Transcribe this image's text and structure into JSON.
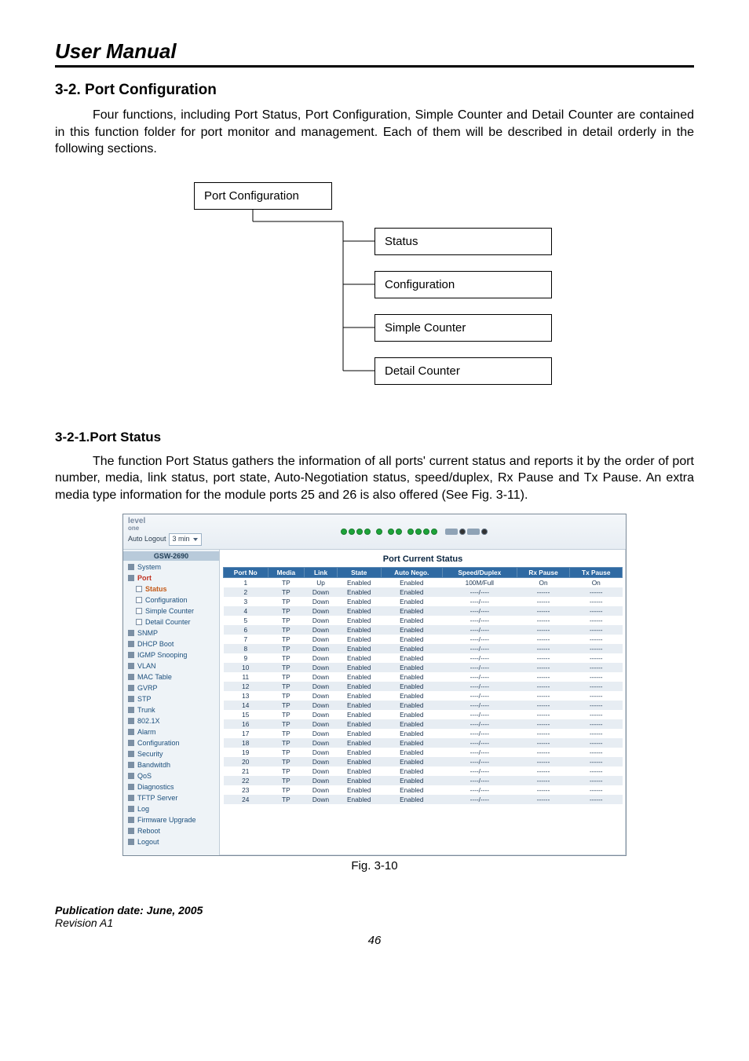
{
  "header": {
    "title": "User Manual"
  },
  "section": {
    "heading": "3-2. Port Configuration",
    "para": "Four functions, including Port Status, Port Configuration, Simple Counter and Detail Counter are contained in this function folder for port monitor and management. Each of them will be described in detail orderly in the following sections."
  },
  "tree": {
    "root": "Port Configuration",
    "children": [
      "Status",
      "Configuration",
      "Simple Counter",
      "Detail Counter"
    ]
  },
  "subsection": {
    "heading": "3-2-1.Port Status",
    "para": "The function Port Status gathers the information of all ports' current status and reports it by the order of port number, media, link status, port state, Auto-Negotiation status, speed/duplex, Rx Pause and Tx Pause. An extra media type information for the module ports 25 and 26 is also offered (See Fig. 3-11)."
  },
  "screenshot": {
    "logo_top": "level",
    "logo_bottom": "one",
    "auto_logout_label": "Auto Logout",
    "auto_logout_value": "3 min",
    "model": "GSW-2690",
    "nav": [
      {
        "label": "System",
        "level": 1,
        "filled": true
      },
      {
        "label": "Port",
        "level": 1,
        "filled": true,
        "selected": "port"
      },
      {
        "label": "Status",
        "level": 2,
        "filled": false,
        "selected": "sub"
      },
      {
        "label": "Configuration",
        "level": 2,
        "filled": false
      },
      {
        "label": "Simple Counter",
        "level": 2,
        "filled": false
      },
      {
        "label": "Detail Counter",
        "level": 2,
        "filled": false
      },
      {
        "label": "SNMP",
        "level": 1,
        "filled": true
      },
      {
        "label": "DHCP Boot",
        "level": 1,
        "filled": true
      },
      {
        "label": "IGMP Snooping",
        "level": 1,
        "filled": true
      },
      {
        "label": "VLAN",
        "level": 1,
        "filled": true
      },
      {
        "label": "MAC Table",
        "level": 1,
        "filled": true
      },
      {
        "label": "GVRP",
        "level": 1,
        "filled": true
      },
      {
        "label": "STP",
        "level": 1,
        "filled": true
      },
      {
        "label": "Trunk",
        "level": 1,
        "filled": true
      },
      {
        "label": "802.1X",
        "level": 1,
        "filled": true
      },
      {
        "label": "Alarm",
        "level": 1,
        "filled": true
      },
      {
        "label": "Configuration",
        "level": 1,
        "filled": true
      },
      {
        "label": "Security",
        "level": 1,
        "filled": true
      },
      {
        "label": "Bandwitdh",
        "level": 1,
        "filled": true
      },
      {
        "label": "QoS",
        "level": 1,
        "filled": true
      },
      {
        "label": "Diagnostics",
        "level": 1,
        "filled": true
      },
      {
        "label": "TFTP Server",
        "level": 1,
        "filled": true
      },
      {
        "label": "Log",
        "level": 1,
        "filled": true
      },
      {
        "label": "Firmware Upgrade",
        "level": 1,
        "filled": true
      },
      {
        "label": "Reboot",
        "level": 1,
        "filled": true
      },
      {
        "label": "Logout",
        "level": 1,
        "filled": true
      }
    ],
    "table": {
      "title": "Port Current Status",
      "headers": [
        "Port No",
        "Media",
        "Link",
        "State",
        "Auto Nego.",
        "Speed/Duplex",
        "Rx Pause",
        "Tx Pause"
      ],
      "rows": [
        [
          "1",
          "TP",
          "Up",
          "Enabled",
          "Enabled",
          "100M/Full",
          "On",
          "On"
        ],
        [
          "2",
          "TP",
          "Down",
          "Enabled",
          "Enabled",
          "----/----",
          "------",
          "------"
        ],
        [
          "3",
          "TP",
          "Down",
          "Enabled",
          "Enabled",
          "----/----",
          "------",
          "------"
        ],
        [
          "4",
          "TP",
          "Down",
          "Enabled",
          "Enabled",
          "----/----",
          "------",
          "------"
        ],
        [
          "5",
          "TP",
          "Down",
          "Enabled",
          "Enabled",
          "----/----",
          "------",
          "------"
        ],
        [
          "6",
          "TP",
          "Down",
          "Enabled",
          "Enabled",
          "----/----",
          "------",
          "------"
        ],
        [
          "7",
          "TP",
          "Down",
          "Enabled",
          "Enabled",
          "----/----",
          "------",
          "------"
        ],
        [
          "8",
          "TP",
          "Down",
          "Enabled",
          "Enabled",
          "----/----",
          "------",
          "------"
        ],
        [
          "9",
          "TP",
          "Down",
          "Enabled",
          "Enabled",
          "----/----",
          "------",
          "------"
        ],
        [
          "10",
          "TP",
          "Down",
          "Enabled",
          "Enabled",
          "----/----",
          "------",
          "------"
        ],
        [
          "11",
          "TP",
          "Down",
          "Enabled",
          "Enabled",
          "----/----",
          "------",
          "------"
        ],
        [
          "12",
          "TP",
          "Down",
          "Enabled",
          "Enabled",
          "----/----",
          "------",
          "------"
        ],
        [
          "13",
          "TP",
          "Down",
          "Enabled",
          "Enabled",
          "----/----",
          "------",
          "------"
        ],
        [
          "14",
          "TP",
          "Down",
          "Enabled",
          "Enabled",
          "----/----",
          "------",
          "------"
        ],
        [
          "15",
          "TP",
          "Down",
          "Enabled",
          "Enabled",
          "----/----",
          "------",
          "------"
        ],
        [
          "16",
          "TP",
          "Down",
          "Enabled",
          "Enabled",
          "----/----",
          "------",
          "------"
        ],
        [
          "17",
          "TP",
          "Down",
          "Enabled",
          "Enabled",
          "----/----",
          "------",
          "------"
        ],
        [
          "18",
          "TP",
          "Down",
          "Enabled",
          "Enabled",
          "----/----",
          "------",
          "------"
        ],
        [
          "19",
          "TP",
          "Down",
          "Enabled",
          "Enabled",
          "----/----",
          "------",
          "------"
        ],
        [
          "20",
          "TP",
          "Down",
          "Enabled",
          "Enabled",
          "----/----",
          "------",
          "------"
        ],
        [
          "21",
          "TP",
          "Down",
          "Enabled",
          "Enabled",
          "----/----",
          "------",
          "------"
        ],
        [
          "22",
          "TP",
          "Down",
          "Enabled",
          "Enabled",
          "----/----",
          "------",
          "------"
        ],
        [
          "23",
          "TP",
          "Down",
          "Enabled",
          "Enabled",
          "----/----",
          "------",
          "------"
        ],
        [
          "24",
          "TP",
          "Down",
          "Enabled",
          "Enabled",
          "----/----",
          "------",
          "------"
        ]
      ]
    }
  },
  "fig_caption": "Fig. 3-10",
  "footer": {
    "pub": "Publication date: June, 2005",
    "rev": "Revision A1",
    "page": "46"
  }
}
